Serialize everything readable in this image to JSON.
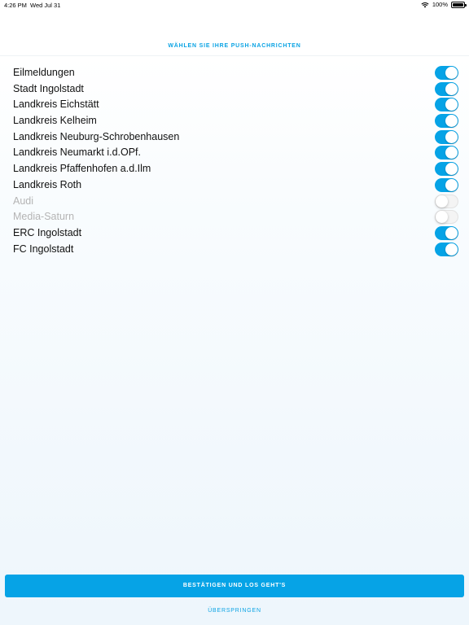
{
  "status_bar": {
    "time": "4:26 PM",
    "date": "Wed Jul 31",
    "battery": "100%"
  },
  "header": {
    "title": "WÄHLEN SIE IHRE PUSH-NACHRICHTEN"
  },
  "items": [
    {
      "label": "Eilmeldungen",
      "enabled": true
    },
    {
      "label": "Stadt Ingolstadt",
      "enabled": true
    },
    {
      "label": "Landkreis Eichstätt",
      "enabled": true
    },
    {
      "label": "Landkreis Kelheim",
      "enabled": true
    },
    {
      "label": "Landkreis Neuburg-Schrobenhausen",
      "enabled": true
    },
    {
      "label": "Landkreis Neumarkt i.d.OPf.",
      "enabled": true
    },
    {
      "label": "Landkreis Pfaffenhofen a.d.Ilm",
      "enabled": true
    },
    {
      "label": "Landkreis Roth",
      "enabled": true
    },
    {
      "label": "Audi",
      "enabled": false
    },
    {
      "label": "Media-Saturn",
      "enabled": false
    },
    {
      "label": "ERC Ingolstadt",
      "enabled": true
    },
    {
      "label": "FC Ingolstadt",
      "enabled": true
    }
  ],
  "footer": {
    "confirm_label": "BESTÄTIGEN UND LOS GEHT'S",
    "skip_label": "ÜBERSPRINGEN"
  },
  "colors": {
    "accent": "#06a3e6",
    "disabled_text": "#b4b4b4"
  }
}
